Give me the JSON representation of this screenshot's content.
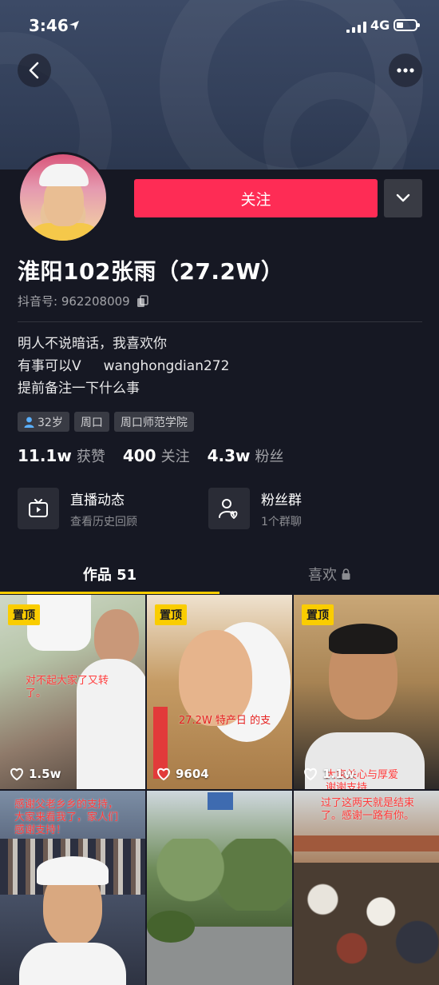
{
  "status_bar": {
    "time": "3:46",
    "network": "4G"
  },
  "profile": {
    "follow_label": "关注",
    "name": "淮阳102张雨（27.2W）",
    "douyin_id": "抖音号: 962208009",
    "bio": {
      "line1": "明人不说暗话，我喜欢你",
      "line2_prefix": "有事可以V",
      "line2_handle": "wanghongdian272",
      "line3": "提前备注一下什么事"
    },
    "tags": {
      "age": "32岁",
      "city": "周口",
      "school": "周口师范学院"
    },
    "stats": {
      "likes": {
        "value": "11.1w",
        "label": "获赞"
      },
      "following": {
        "value": "400",
        "label": "关注"
      },
      "fans": {
        "value": "4.3w",
        "label": "粉丝"
      }
    },
    "features": {
      "live": {
        "title": "直播动态",
        "subtitle": "查看历史回顾"
      },
      "fans_group": {
        "title": "粉丝群",
        "subtitle": "1个群聊"
      }
    }
  },
  "tabs": {
    "works": "作品 51",
    "likes": "喜欢"
  },
  "videos": [
    {
      "pinned": "置顶",
      "likes": "1.5w",
      "caption": "对不起大家了又转\n了。"
    },
    {
      "pinned": "置顶",
      "likes": "9604",
      "caption": "27.2W 特产日 的支"
    },
    {
      "pinned": "置顶",
      "likes": "1.1w",
      "caption": "大家关心与厚爱\n谢谢支持"
    },
    {
      "caption": "感谢父老乡乡的支持，\n大家来看我了，家人们\n感谢支持！"
    },
    {
      "caption": ""
    },
    {
      "caption": "过了这两天就是结束\n了。感谢一路有你。"
    }
  ],
  "colors": {
    "follow": "#fe2c55",
    "accent": "#facd00",
    "background": "#161823"
  }
}
